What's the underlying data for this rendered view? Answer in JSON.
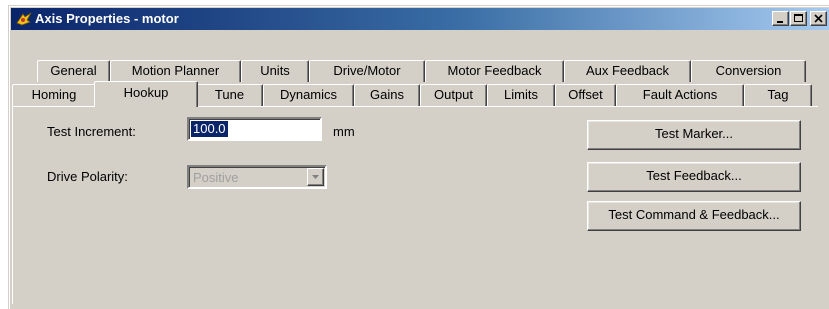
{
  "window": {
    "title": "Axis Properties - motor",
    "icon": "axis-properties-icon",
    "controls": [
      "minimize-icon",
      "maximize-icon",
      "close-icon"
    ]
  },
  "tabs": {
    "row1": [
      "General",
      "Motion Planner",
      "Units",
      "Drive/Motor",
      "Motor Feedback",
      "Aux Feedback",
      "Conversion"
    ],
    "row2": [
      "Homing",
      "Hookup",
      "Tune",
      "Dynamics",
      "Gains",
      "Output",
      "Limits",
      "Offset",
      "Fault Actions",
      "Tag"
    ],
    "selected": "Hookup"
  },
  "hookup": {
    "test_increment_label": "Test Increment:",
    "test_increment_value": "100.0",
    "test_increment_unit": "mm",
    "drive_polarity_label": "Drive Polarity:",
    "drive_polarity_value": "Positive",
    "drive_polarity_enabled": false
  },
  "buttons": {
    "test_marker": "Test Marker...",
    "test_feedback": "Test Feedback...",
    "test_command_feedback": "Test Command & Feedback..."
  },
  "colors": {
    "titlebar_start": "#0a246a",
    "titlebar_end": "#a6caf0",
    "face": "#d4d0c8",
    "selection": "#0a246a"
  }
}
